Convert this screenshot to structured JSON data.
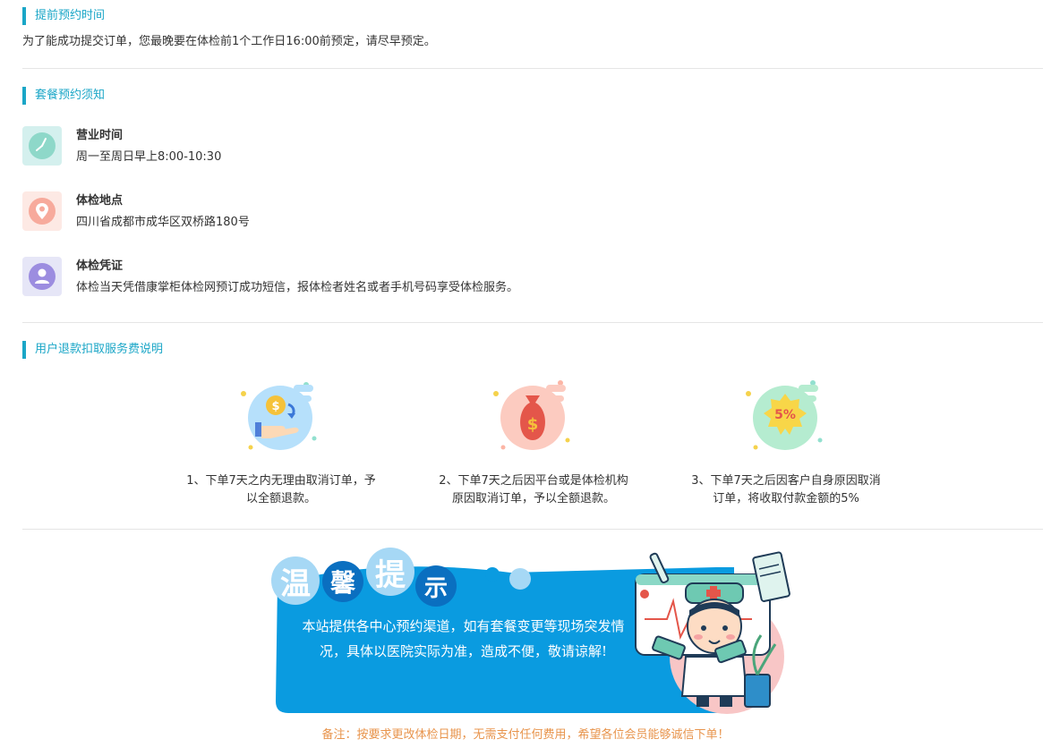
{
  "advance": {
    "title": "提前预约时间",
    "text": "为了能成功提交订单，您最晚要在体检前1个工作日16:00前预定，请尽早预定。"
  },
  "notice": {
    "title": "套餐预约须知",
    "items": [
      {
        "label": "营业时间",
        "value": "周一至周日早上8:00-10:30",
        "icon": "clock-icon"
      },
      {
        "label": "体检地点",
        "value": "四川省成都市成华区双桥路180号",
        "icon": "location-pin-icon"
      },
      {
        "label": "体检凭证",
        "value": "体检当天凭借康掌柜体检网预订成功短信，报体检者姓名或者手机号码享受体检服务。",
        "icon": "user-icon"
      }
    ]
  },
  "refund": {
    "title": "用户退款扣取服务费说明",
    "items": [
      {
        "line1": "1、下单7天之内无理由取消订单，予",
        "line2": "以全额退款。",
        "icon": "coin-hand-icon"
      },
      {
        "line1": "2、下单7天之后因平台或是体检机构",
        "line2": "原因取消订单，予以全额退款。",
        "icon": "money-bag-icon"
      },
      {
        "line1": "3、下单7天之后因客户自身原因取消",
        "line2": "订单，将收取付款金额的5%",
        "icon": "percent-badge-icon",
        "badge": "5%"
      }
    ]
  },
  "tip": {
    "chars": [
      "温",
      "馨",
      "提",
      "示"
    ],
    "line1": "本站提供各中心预约渠道，如有套餐变更等现场突发情",
    "line2": "况，具体以医院实际为准，造成不便，敬请谅解!",
    "illustration": "doctor-illustration"
  },
  "remark": "备注：按要求更改体检日期，无需支付任何费用，希望各位会员能够诚信下单！",
  "colors": {
    "accent": "#1aa6c7",
    "banner": "#0a9be0",
    "remark": "#e8944c"
  }
}
